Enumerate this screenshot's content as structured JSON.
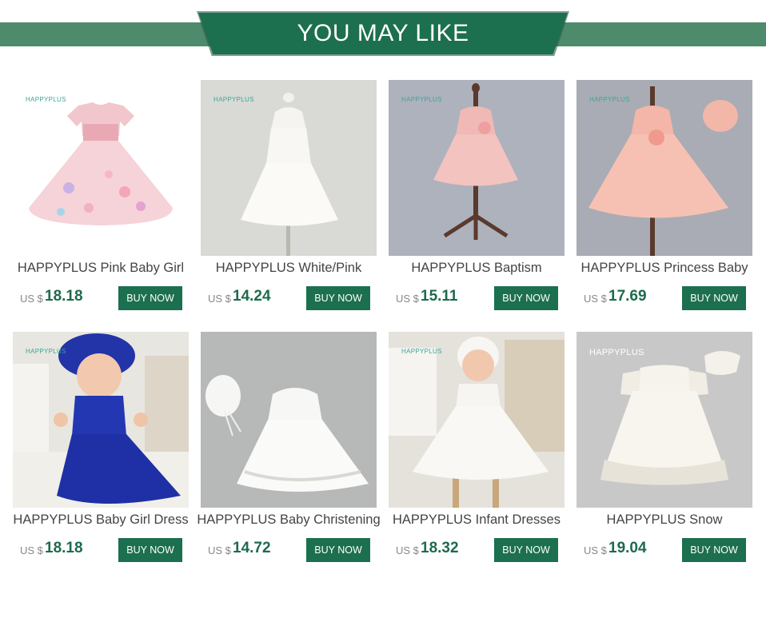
{
  "header": {
    "title": "YOU MAY LIKE"
  },
  "products": [
    {
      "brand": "HAPPYPLUS",
      "title": "HAPPYPLUS Pink Baby Girl",
      "currency": "US $",
      "price": "18.18",
      "button": "BUY NOW"
    },
    {
      "brand": "HAPPYPLUS",
      "title": "HAPPYPLUS White/Pink",
      "currency": "US $",
      "price": "14.24",
      "button": "BUY NOW"
    },
    {
      "brand": "HAPPYPLUS",
      "title": "HAPPYPLUS Baptism",
      "currency": "US $",
      "price": "15.11",
      "button": "BUY NOW"
    },
    {
      "brand": "HAPPYPLUS",
      "title": "HAPPYPLUS Princess Baby",
      "currency": "US $",
      "price": "17.69",
      "button": "BUY NOW"
    },
    {
      "brand": "HAPPYPLUS",
      "title": "HAPPYPLUS Baby Girl Dress",
      "currency": "US $",
      "price": "18.18",
      "button": "BUY NOW"
    },
    {
      "brand": "",
      "title": "HAPPYPLUS Baby Christening",
      "currency": "US $",
      "price": "14.72",
      "button": "BUY NOW"
    },
    {
      "brand": "HAPPYPLUS",
      "title": "HAPPYPLUS Infant Dresses",
      "currency": "US $",
      "price": "18.32",
      "button": "BUY NOW"
    },
    {
      "brand": "HAPPYPLUS",
      "title": "HAPPYPLUS Snow",
      "currency": "US $",
      "price": "19.04",
      "button": "BUY NOW"
    }
  ]
}
